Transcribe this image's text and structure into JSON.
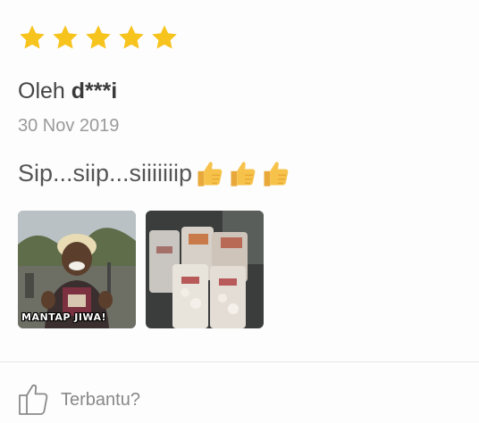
{
  "review": {
    "rating": 5,
    "rating_max": 5,
    "author_prefix": "Oleh",
    "author_name": "d***i",
    "date": "30 Nov 2019",
    "comment": "Sip...siip...siiiiiiip",
    "comment_emoji_count": 3,
    "photos": [
      {
        "caption": "MANTAP JIWA!",
        "icon": "meme-photo"
      },
      {
        "caption": "",
        "icon": "popcorn-bags-photo"
      }
    ],
    "helpful_label": "Terbantu?"
  },
  "colors": {
    "star": "#f7c31d",
    "emoji": "#f6c24a",
    "muted_text": "#9a9a9a",
    "divider": "#e6e6e6"
  }
}
